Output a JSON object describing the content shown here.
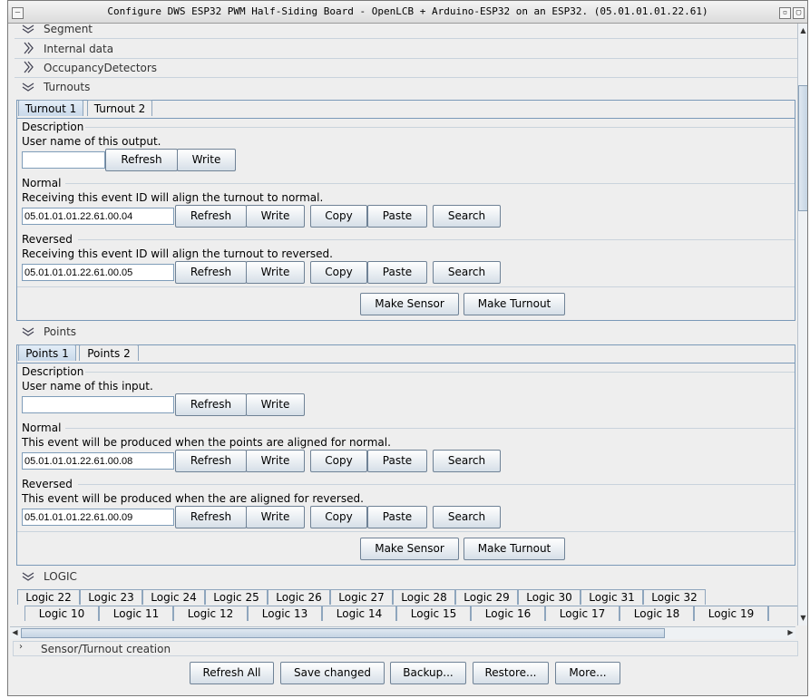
{
  "window": {
    "title": "Configure DWS ESP32 PWM Half-Siding Board - OpenLCB + Arduino-ESP32 on an ESP32. (05.01.01.01.22.61)"
  },
  "sections": {
    "segment": "Segment",
    "internal_data": "Internal data",
    "occupancy": "OccupancyDetectors",
    "turnouts": "Turnouts",
    "points": "Points",
    "logic": "LOGIC",
    "sensor_creation": "Sensor/Turnout creation"
  },
  "turnouts": {
    "tabs": [
      "Turnout 1",
      "Turnout 2"
    ],
    "description": {
      "title": "Description",
      "text": "User name of this output.",
      "value": ""
    },
    "normal": {
      "title": "Normal",
      "text": "Receiving this event ID will align the turnout to normal.",
      "value": "05.01.01.01.22.61.00.04"
    },
    "reversed": {
      "title": "Reversed",
      "text": "Receiving this event ID will align the turnout to reversed.",
      "value": "05.01.01.01.22.61.00.05"
    }
  },
  "points": {
    "tabs": [
      "Points 1",
      "Points 2"
    ],
    "description": {
      "title": "Description",
      "text": "User name of this input.",
      "value": ""
    },
    "normal": {
      "title": "Normal",
      "text": "This event will be produced when the points are aligned for normal.",
      "value": "05.01.01.01.22.61.00.08"
    },
    "reversed": {
      "title": "Reversed",
      "text": "This event will be produced when the are aligned for reversed.",
      "value": "05.01.01.01.22.61.00.09"
    }
  },
  "buttons": {
    "refresh": "Refresh",
    "write": "Write",
    "copy": "Copy",
    "paste": "Paste",
    "search": "Search",
    "make_sensor": "Make Sensor",
    "make_turnout": "Make Turnout"
  },
  "logic_tabs_row1": [
    "Logic 22",
    "Logic 23",
    "Logic 24",
    "Logic 25",
    "Logic 26",
    "Logic 27",
    "Logic 28",
    "Logic 29",
    "Logic 30",
    "Logic 31",
    "Logic 32"
  ],
  "logic_tabs_row2": [
    "Logic 10",
    "Logic 11",
    "Logic 12",
    "Logic 13",
    "Logic 14",
    "Logic 15",
    "Logic 16",
    "Logic 17",
    "Logic 18",
    "Logic 19",
    "Lo"
  ],
  "footer": {
    "refresh_all": "Refresh All",
    "save_changed": "Save changed",
    "backup": "Backup...",
    "restore": "Restore...",
    "more": "More..."
  }
}
